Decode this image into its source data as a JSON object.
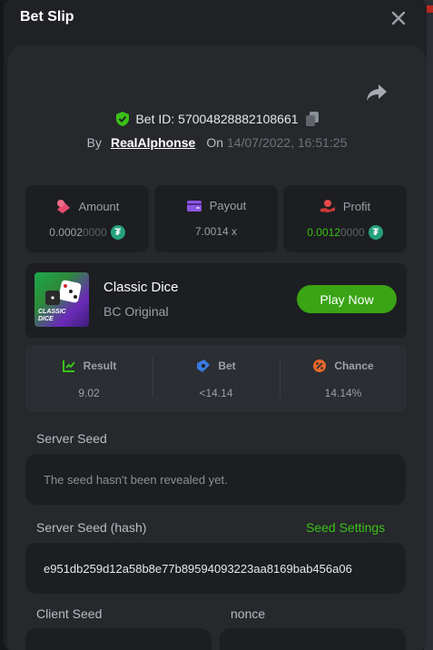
{
  "header": {
    "title": "Bet Slip"
  },
  "icons": {
    "close": "close-icon",
    "share": "share-icon",
    "shield": "shield-check-icon",
    "copy": "copy-icon",
    "amount": "coins-icon",
    "payout": "wallet-icon",
    "profit": "hand-coin-icon",
    "result": "chart-check-icon",
    "bet": "ticket-icon",
    "chance": "percent-icon",
    "tether": "tether-coin-icon"
  },
  "bet": {
    "id_label": "Bet ID: 57004828882108661",
    "by_label": "By",
    "user": "RealAlphonse",
    "on_label": "On",
    "date": "14/07/2022, 16:51:25"
  },
  "stats": {
    "amount": {
      "label": "Amount",
      "value_main": "0.0002",
      "value_dim": "0000",
      "currency_glyph": "₮"
    },
    "payout": {
      "label": "Payout",
      "value": "7.0014 x"
    },
    "profit": {
      "label": "Profit",
      "value_main": "0.0012",
      "value_dim": "0000",
      "currency_glyph": "₮"
    }
  },
  "game": {
    "name": "Classic Dice",
    "provider": "BC Original",
    "thumb_text_1": "CLASSIC",
    "thumb_text_2": "DICE",
    "play_label": "Play Now"
  },
  "result": {
    "result_label": "Result",
    "result_value": "9.02",
    "bet_label": "Bet",
    "bet_value": "<14.14",
    "chance_label": "Chance",
    "chance_value": "14.14%"
  },
  "seeds": {
    "server_seed_label": "Server Seed",
    "server_seed_value": "The seed hasn't been revealed yet.",
    "server_hash_label": "Server Seed (hash)",
    "seed_settings_label": "Seed Settings",
    "server_hash_value": "e951db259d12a58b8e77b89594093223aa8169bab456a06",
    "client_seed_label": "Client Seed",
    "nonce_label": "nonce"
  },
  "colors": {
    "accent_green": "#3bc117",
    "play_button": "#3aa415",
    "panel": "#26282c",
    "card": "#1c1e21"
  }
}
